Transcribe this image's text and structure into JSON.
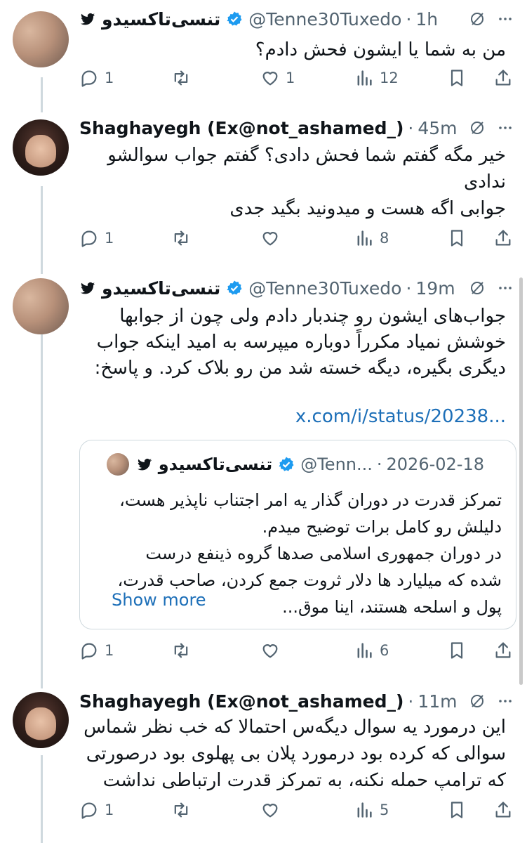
{
  "tweets": [
    {
      "author": "تنسی‌تاکسیدو",
      "handle": "@Tenne30Tuxedo",
      "time": "1h",
      "text": "من به شما یا ایشون فحش دادم؟",
      "reply_count": "1",
      "like_count": "1",
      "view_count": "12"
    },
    {
      "author": "Shaghayegh (Ex@not_ashamed_)",
      "handle": "",
      "time": "45m",
      "text": "خیر مگه گفتم شما فحش دادی؟ گفتم جواب سوالشو ندادی\nجوابی اگه هست و میدونید بگید جدی",
      "reply_count": "1",
      "like_count": "",
      "view_count": "8"
    },
    {
      "author": "تنسی‌تاکسیدو",
      "handle": "@Tenne30Tuxedo",
      "time": "19m",
      "text": "جواب‌های ایشون رو چندبار دادم ولی چون از جوابها خوشش نمیاد مکرراً دوباره میپرسه به امید اینکه جواب دیگری بگیره، دیگه خسته شد من رو بلاک کرد. و پاسخ:",
      "link": "x.com/i/status/20238...",
      "reply_count": "1",
      "like_count": "",
      "view_count": "6",
      "quote": {
        "author": "تنسی‌تاکسیدو",
        "handle": "@Tenn...",
        "date": "2026-02-18",
        "text": "تمرکز قدرت در دوران گذار یه امر اجتناب ناپذیر هست، دلیلش رو کامل برات توضیح میدم.\nدر دوران جمهوری اسلامی صدها گروه ذینفع درست شده که میلیارد ها دلار ثروت جمع کردن، صاحب قدرت، پول و اسلحه هستند، اینا موق...",
        "show_more": "Show more"
      }
    },
    {
      "author": "Shaghayegh (Ex@not_ashamed_)",
      "handle": "",
      "time": "11m",
      "text": "این درمورد یه سوال دیگه‌س احتمالا که خب نظر شماس سوالی که کرده بود درمورد پلان بی پهلوی بود درصورتی که ترامپ حمله نکنه، به تمرکز قدرت ارتباطی نداشت",
      "reply_count": "1",
      "like_count": "",
      "view_count": "5"
    }
  ],
  "separator": "·",
  "colors": {
    "text": "#0f1419",
    "muted": "#536471",
    "link": "#1d6fb8",
    "verified": "#1d9bf0",
    "border": "#cfd9de"
  },
  "icons": [
    "x-logo-icon",
    "verified-badge-icon",
    "grok-icon",
    "more-icon",
    "reply-icon",
    "retweet-icon",
    "like-icon",
    "views-icon",
    "bookmark-icon",
    "share-icon"
  ]
}
